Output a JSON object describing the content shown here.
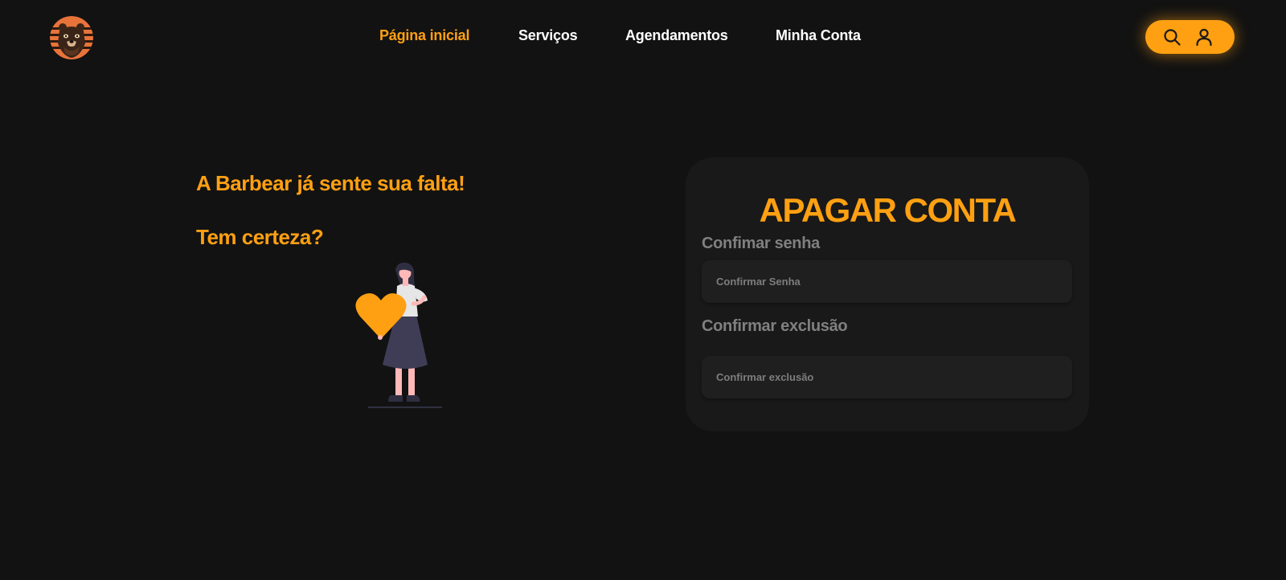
{
  "header": {
    "logo_icon": "bear-logo-icon",
    "nav": [
      {
        "label": "Página inicial",
        "active": true
      },
      {
        "label": "Serviços",
        "active": false
      },
      {
        "label": "Agendamentos",
        "active": false
      },
      {
        "label": "Minha Conta",
        "active": false
      }
    ],
    "actions": {
      "search_icon": "search-icon",
      "user_icon": "user-icon"
    }
  },
  "farewell": {
    "line1": "A Barbear já sente sua falta!",
    "line2": "Tem certeza?",
    "illustration": "woman-holding-heart-illustration"
  },
  "delete_account": {
    "title": "APAGAR CONTA",
    "password": {
      "label": "Confimar senha",
      "placeholder": "Confirmar Senha",
      "value": ""
    },
    "confirmation": {
      "label": "Confirmar exclusão",
      "placeholder": "Confirmar exclusão",
      "value": ""
    }
  },
  "colors": {
    "accent": "#ffa012",
    "background": "#121212",
    "card": "#191919",
    "input": "#1f1f1f",
    "muted_text": "#808080"
  }
}
